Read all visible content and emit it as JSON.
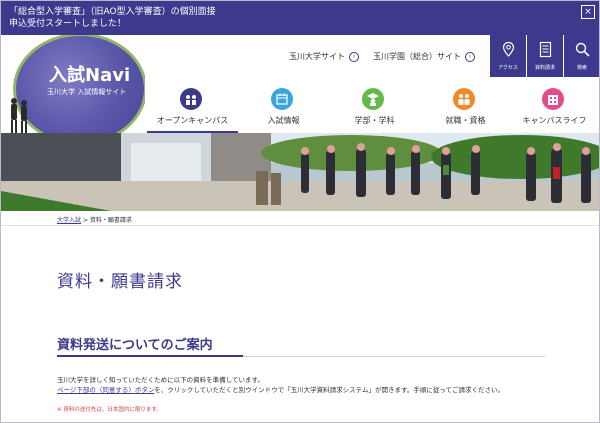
{
  "notice": {
    "line1": "「総合型入学審査」（旧AO型入学審査）の個別面接",
    "line2": "申込受付スタートしました！",
    "close_label": "×"
  },
  "logo": {
    "title": "入試Navi",
    "subtitle": "玉川大学 入試情報サイト"
  },
  "toplinks": [
    {
      "label": "玉川大学サイト"
    },
    {
      "label": "玉川学園（総合）サイト"
    }
  ],
  "utility": [
    {
      "label": "アクセス",
      "icon": "map-pin-icon"
    },
    {
      "label": "資料請求",
      "icon": "document-icon"
    },
    {
      "label": "検索",
      "icon": "search-icon"
    }
  ],
  "nav": [
    {
      "label": "オープンキャンパス",
      "color": "#3d3a8e",
      "icon": "campus-icon"
    },
    {
      "label": "入試情報",
      "color": "#3aa5dc",
      "icon": "calendar-icon"
    },
    {
      "label": "学部・学科",
      "color": "#65b94a",
      "icon": "graduate-icon"
    },
    {
      "label": "就職・資格",
      "color": "#f08a28",
      "icon": "people-icon"
    },
    {
      "label": "キャンパスライフ",
      "color": "#e34b8c",
      "icon": "building-icon"
    }
  ],
  "breadcrumb": {
    "home": "大学入試",
    "separator": ">",
    "current": "資料・願書請求"
  },
  "page_title": "資料・願書請求",
  "section_title": "資料発送についてのご案内",
  "body": {
    "line1": "玉川大学を詳しく知っていただくために以下の資料を準備しています。",
    "line2_link": "ページ下部の〈同意する〉ボタン",
    "line2_rest": "を、クリックしていただくと別ウインドウで「玉川大学資料請求システム」が開きます。手順に従ってご請求ください。",
    "note": "※ 資料の送付先は、日本国内に限ります。"
  },
  "colors": {
    "brand": "#3d3a8e",
    "note_red": "#e04040"
  }
}
